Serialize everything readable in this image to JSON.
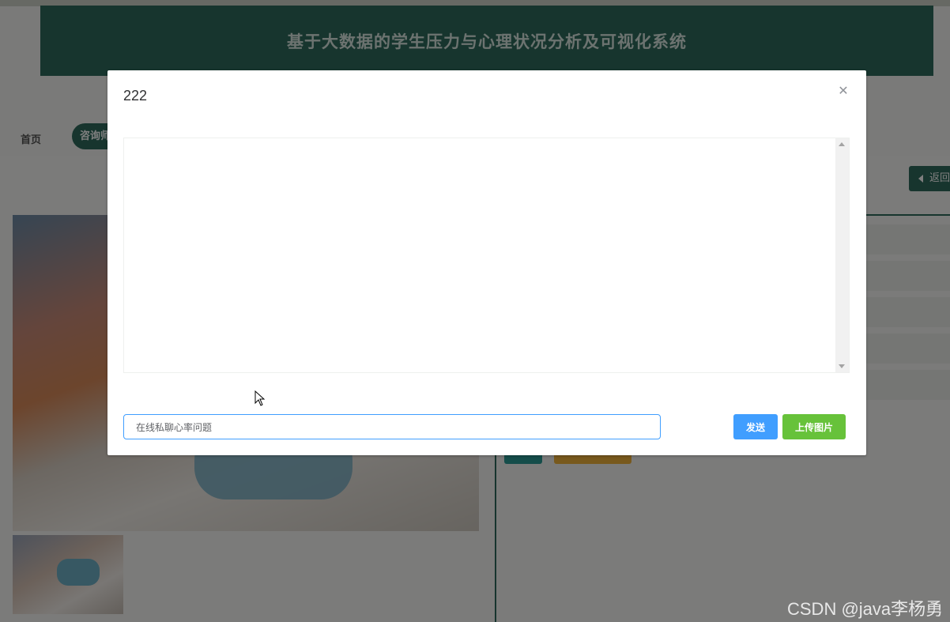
{
  "page": {
    "banner_title": "基于大数据的学生压力与心理状况分析及可视化系统",
    "nav": {
      "home": "首页",
      "active": "咨询师"
    },
    "back_label": "返回"
  },
  "modal": {
    "title": "222",
    "input": {
      "value": "在线私聊心率问题",
      "placeholder": ""
    },
    "send_label": "发送",
    "upload_label": "上传图片"
  },
  "watermark": "CSDN @java李杨勇",
  "icons": {
    "close": "close-icon",
    "back": "caret-left-icon",
    "cursor": "mouse-pointer-icon"
  },
  "colors": {
    "brand": "#2f6b5d",
    "send": "#409eff",
    "upload": "#67c23a"
  }
}
